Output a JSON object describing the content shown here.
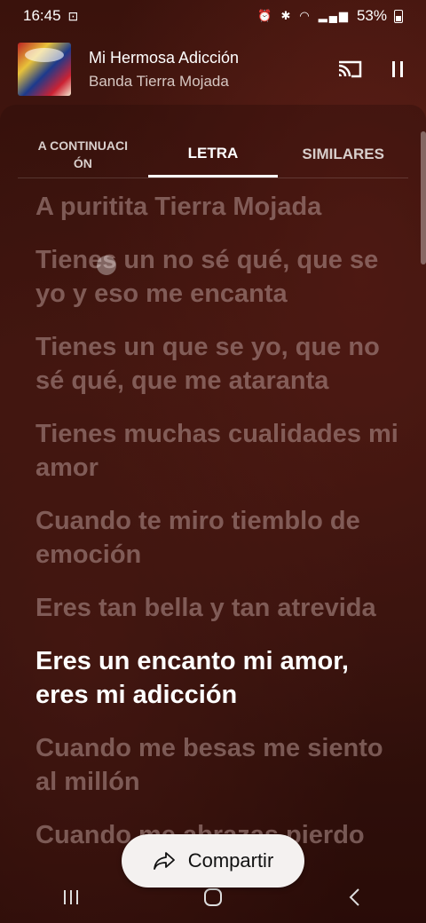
{
  "status": {
    "time": "16:45",
    "battery": "53%"
  },
  "now_playing": {
    "title": "Mi Hermosa Adicción",
    "artist": "Banda Tierra Mojada"
  },
  "tabs": [
    {
      "label": "A CONTINUACI\nÓN"
    },
    {
      "label": "LETRA"
    },
    {
      "label": "SIMILARES"
    }
  ],
  "lyrics": [
    {
      "text": "A puritita Tierra Mojada"
    },
    {
      "text": "Tienes un no sé qué, que se yo y eso me encanta"
    },
    {
      "text": "Tienes un que se yo, que no sé qué, que me ataranta"
    },
    {
      "text": "Tienes muchas cualidades mi amor"
    },
    {
      "text": "Cuando te miro tiemblo de emoción"
    },
    {
      "text": "Eres tan bella y tan atrevida"
    },
    {
      "text": "Eres un encanto mi amor, eres mi adicción"
    },
    {
      "text": "Cuando me besas me siento al millón"
    },
    {
      "text": "Cuando me abrazas pierdo"
    }
  ],
  "share": {
    "label": "Compartir"
  }
}
